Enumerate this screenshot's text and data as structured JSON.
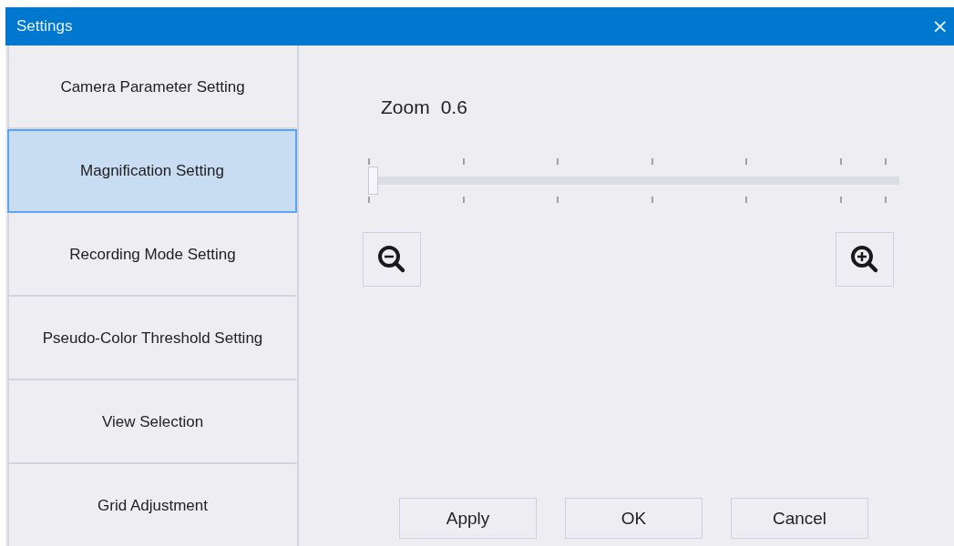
{
  "window": {
    "title": "Settings",
    "close": "×"
  },
  "sidebar": {
    "items": [
      {
        "label": "Camera Parameter Setting",
        "selected": false
      },
      {
        "label": "Magnification Setting",
        "selected": true
      },
      {
        "label": "Recording Mode Setting",
        "selected": false
      },
      {
        "label": "Pseudo-Color Threshold Setting",
        "selected": false
      },
      {
        "label": "View Selection",
        "selected": false
      },
      {
        "label": "Grid Adjustment",
        "selected": false
      }
    ]
  },
  "zoom": {
    "label": "Zoom",
    "value": "0.6",
    "slider": {
      "level": 0
    }
  },
  "buttons": [
    "Apply",
    "OK",
    "Cancel"
  ]
}
